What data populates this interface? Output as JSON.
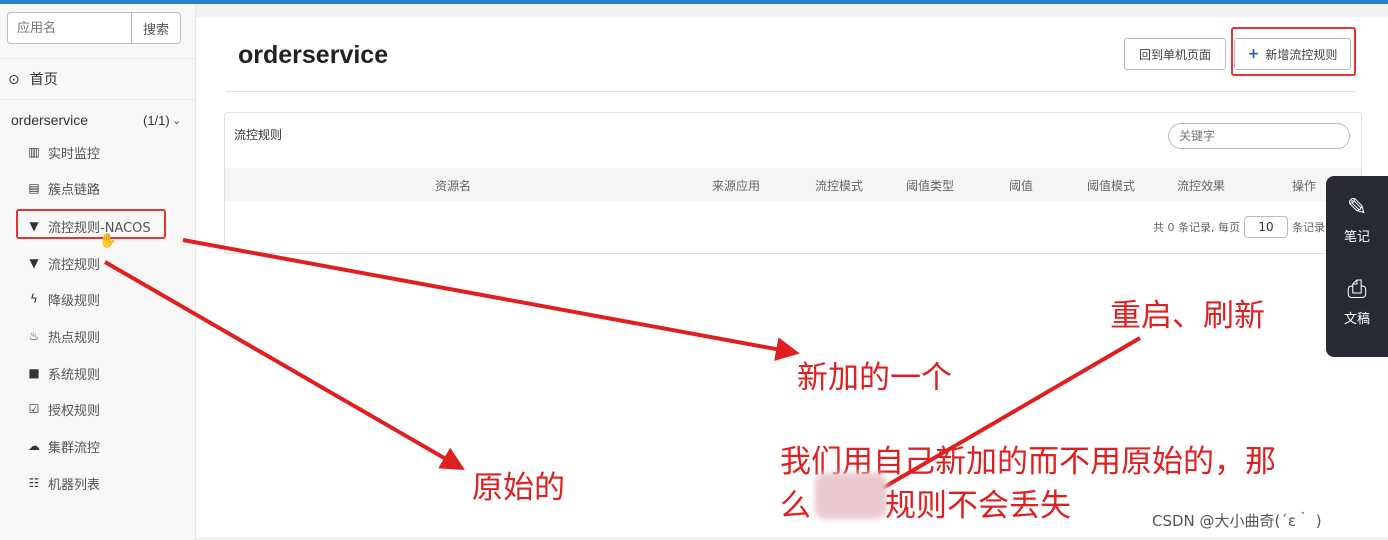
{
  "sidebar": {
    "search_placeholder": "应用名",
    "search_button": "搜索",
    "home_label": "首页",
    "app_name": "orderservice",
    "app_count": "(1/1)",
    "items": [
      {
        "label": "实时监控",
        "icon": "bar-chart-icon"
      },
      {
        "label": "簇点链路",
        "icon": "list-icon"
      },
      {
        "label": "流控规则-NACOS",
        "icon": "filter-icon"
      },
      {
        "label": "流控规则",
        "icon": "filter-icon"
      },
      {
        "label": "降级规则",
        "icon": "flash-icon"
      },
      {
        "label": "热点规则",
        "icon": "fire-icon"
      },
      {
        "label": "系统规则",
        "icon": "lock-icon"
      },
      {
        "label": "授权规则",
        "icon": "check-square-icon"
      },
      {
        "label": "集群流控",
        "icon": "cloud-icon"
      },
      {
        "label": "机器列表",
        "icon": "grid-list-icon"
      }
    ]
  },
  "main": {
    "title": "orderservice",
    "back_button": "回到单机页面",
    "add_button": "新增流控规则",
    "card_title": "流控规则",
    "keyword_placeholder": "关键字",
    "columns": [
      "资源名",
      "来源应用",
      "流控模式",
      "阈值类型",
      "阈值",
      "阈值模式",
      "流控效果",
      "操作"
    ],
    "pager": {
      "total_text": "共 0 条记录, 每页",
      "page_size": "10",
      "unit_text": "条记录"
    }
  },
  "float_bar": {
    "items": [
      {
        "label": "笔记",
        "icon": "note-icon"
      },
      {
        "label": "文稿",
        "icon": "doc-ai-icon"
      }
    ]
  },
  "annotations": {
    "restart_refresh": "重启、刷新",
    "new_added": "新加的一个",
    "original": "原始的",
    "note_line1": "我们用自己新加的而不用原始的，那",
    "note_line2_prefix": "么",
    "note_line2_suffix": "规则不会丢失",
    "color": "#e02020"
  },
  "watermark": "CSDN @大小曲奇(´ε｀ )"
}
